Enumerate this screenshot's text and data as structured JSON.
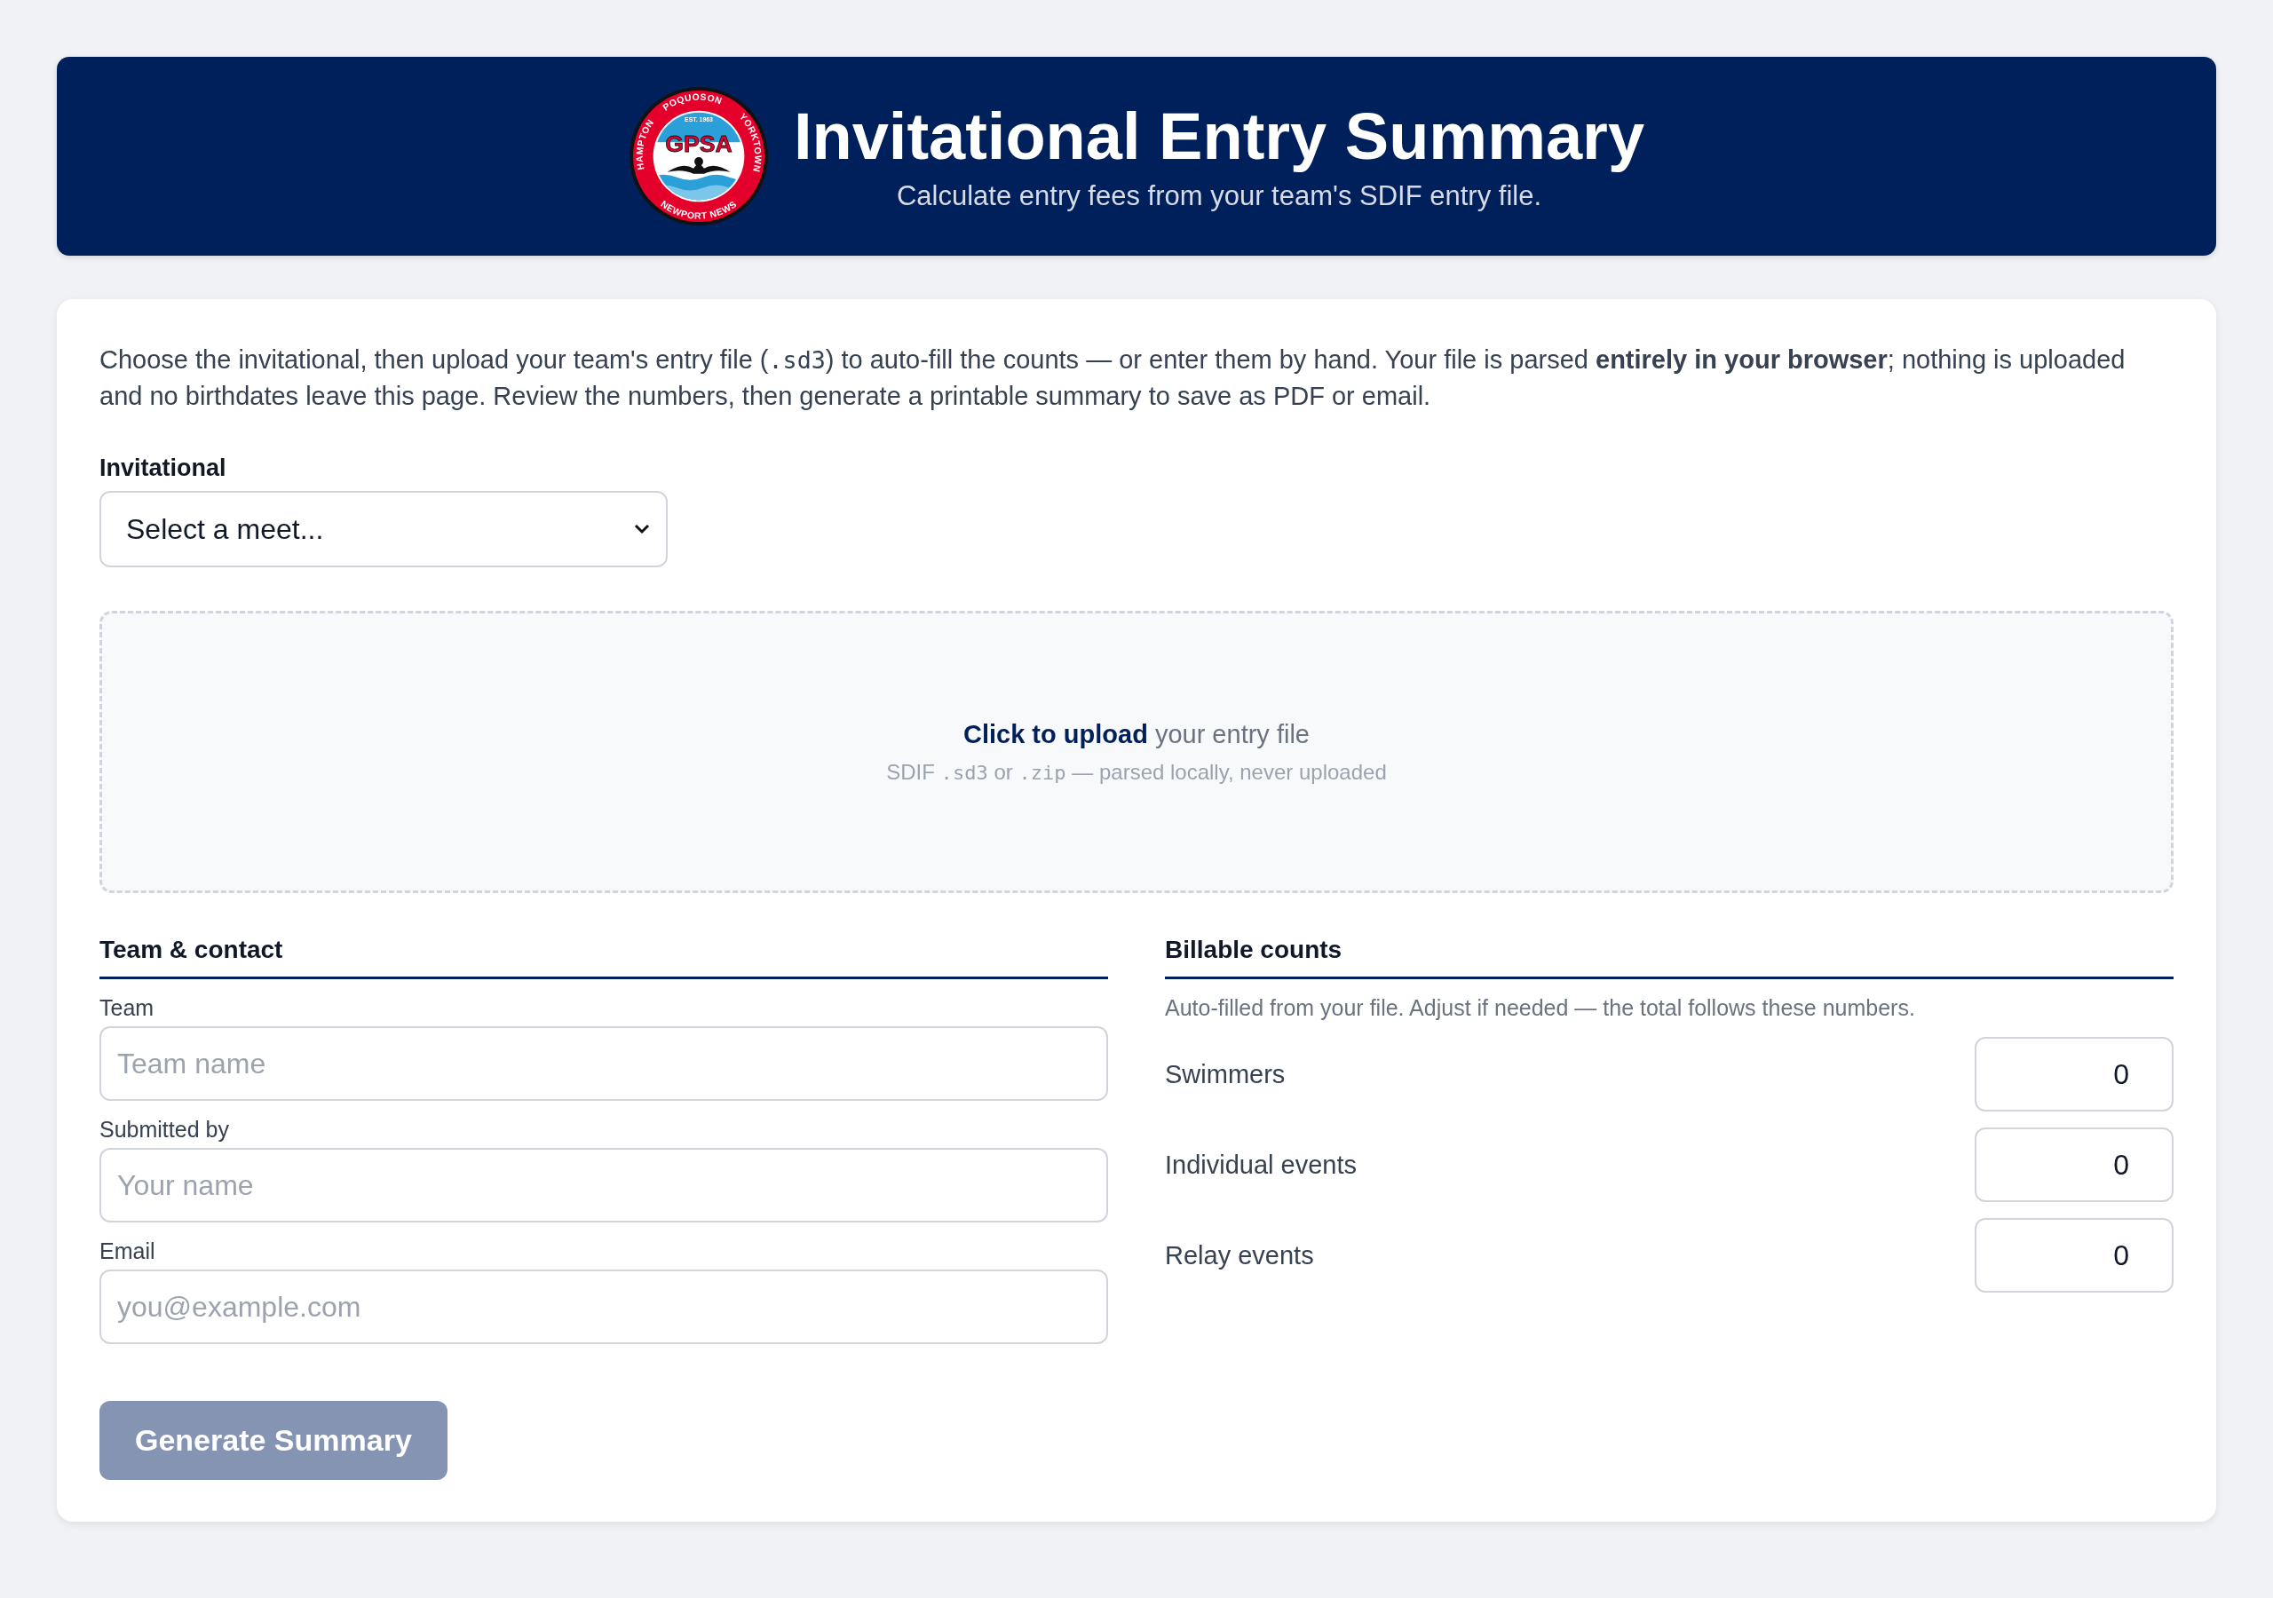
{
  "header": {
    "logo": {
      "name": "GPSA",
      "established": "EST. 1963",
      "ring_top": [
        "HAMPTON",
        "POQUOSON",
        "YORKTOWN"
      ],
      "ring_bottom": "NEWPORT NEWS"
    },
    "title": "Invitational Entry Summary",
    "subtitle": "Calculate entry fees from your team's SDIF entry file."
  },
  "intro": [
    {
      "kind": "text",
      "text": "Choose the invitational, then upload your team's entry file ("
    },
    {
      "kind": "code",
      "text": ".sd3"
    },
    {
      "kind": "text",
      "text": ") to auto-fill the counts — or enter them by hand. Your file is parsed "
    },
    {
      "kind": "bold",
      "text": "entirely in your browser"
    },
    {
      "kind": "text",
      "text": "; nothing is uploaded and no birthdates leave this page. Review the numbers, then generate a printable summary to save as PDF or email."
    }
  ],
  "invitational": {
    "label": "Invitational",
    "value": "Select a meet..."
  },
  "upload": {
    "link": "Click to upload",
    "text": "your entry file",
    "hint": [
      {
        "kind": "text",
        "text": "SDIF "
      },
      {
        "kind": "code",
        "text": ".sd3"
      },
      {
        "kind": "text",
        "text": " or "
      },
      {
        "kind": "code",
        "text": ".zip"
      },
      {
        "kind": "text",
        "text": " — parsed locally, never uploaded"
      }
    ]
  },
  "team_contact": {
    "heading": "Team & contact",
    "fields": [
      {
        "label": "Team",
        "placeholder": "Team name"
      },
      {
        "label": "Submitted by",
        "placeholder": "Your name"
      },
      {
        "label": "Email",
        "placeholder": "you@example.com"
      }
    ]
  },
  "billable_counts": {
    "heading": "Billable counts",
    "note": "Auto-filled from your file. Adjust if needed — the total follows these numbers.",
    "rows": [
      {
        "label": "Swimmers",
        "value": "0"
      },
      {
        "label": "Individual events",
        "value": "0"
      },
      {
        "label": "Relay events",
        "value": "0"
      }
    ]
  },
  "generate_button": {
    "label": "Generate Summary",
    "disabled": true
  }
}
